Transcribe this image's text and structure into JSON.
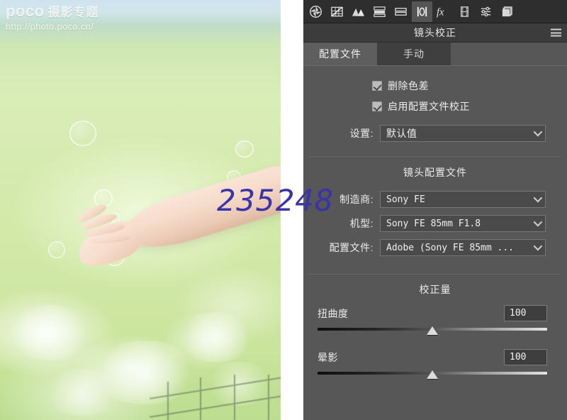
{
  "photo": {
    "watermark_brand": "poco",
    "watermark_title": "摄影专题",
    "watermark_url": "http://photo.poco.cn/",
    "overlay_number": "235248",
    "overlay_color": "#3b33a8",
    "alt": "A hand reaching out with soap bubbles over blurred green grass"
  },
  "panel": {
    "title": "镜头校正",
    "menu_icon": "hamburger-menu-icon",
    "toolbar": [
      {
        "name": "basic-adjustments-icon",
        "label": "基本"
      },
      {
        "name": "tone-curve-icon",
        "label": "色调曲线"
      },
      {
        "name": "detail-icon",
        "label": "细节"
      },
      {
        "name": "color-mixer-icon",
        "label": "混色器"
      },
      {
        "name": "color-grading-icon",
        "label": "颜色分级"
      },
      {
        "name": "lens-corrections-icon",
        "label": "镜头校正",
        "active": true
      },
      {
        "name": "effects-fx-icon",
        "label": "效果"
      },
      {
        "name": "calibration-icon",
        "label": "校准"
      },
      {
        "name": "presets-icon",
        "label": "预设"
      },
      {
        "name": "snapshots-icon",
        "label": "快照"
      }
    ],
    "tabs": [
      {
        "label": "配置文件",
        "active": true
      },
      {
        "label": "手动",
        "active": false
      }
    ],
    "checkboxes": [
      {
        "label": "删除色差",
        "checked": true
      },
      {
        "label": "启用配置文件校正",
        "checked": true
      }
    ],
    "settings": {
      "label": "设置:",
      "value": "默认值"
    },
    "lens_profile": {
      "heading": "镜头配置文件",
      "fields": [
        {
          "label": "制造商:",
          "value": "Sony FE"
        },
        {
          "label": "机型:",
          "value": "Sony FE 85mm F1.8"
        },
        {
          "label": "配置文件:",
          "value": "Adobe (Sony FE 85mm ..."
        }
      ]
    },
    "correction_amount": {
      "heading": "校正量",
      "sliders": [
        {
          "label": "扭曲度",
          "value": "100",
          "position_pct": 50
        },
        {
          "label": "晕影",
          "value": "100",
          "position_pct": 50
        }
      ]
    }
  }
}
